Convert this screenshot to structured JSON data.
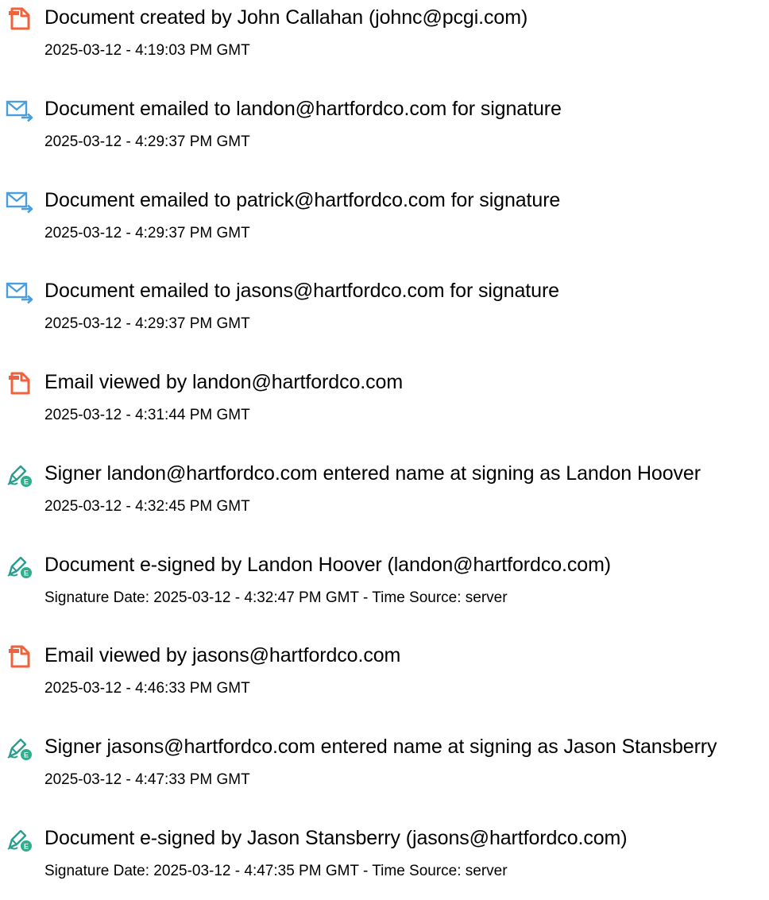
{
  "colors": {
    "doc_icon": "#f0623c",
    "email_icon": "#4a9ede",
    "sign_pen": "#2a9d8f",
    "sign_badge": "#2eaf8c",
    "text": "#000000"
  },
  "events": [
    {
      "icon": "document-icon",
      "title": "Document created by John Callahan (johnc@pcgi.com)",
      "stamp": "2025-03-12 - 4:19:03 PM GMT"
    },
    {
      "icon": "email-sent-icon",
      "title": "Document emailed to landon@hartfordco.com for signature",
      "stamp": "2025-03-12 - 4:29:37 PM GMT"
    },
    {
      "icon": "email-sent-icon",
      "title": "Document emailed to patrick@hartfordco.com for signature",
      "stamp": "2025-03-12 - 4:29:37 PM GMT"
    },
    {
      "icon": "email-sent-icon",
      "title": "Document emailed to jasons@hartfordco.com for signature",
      "stamp": "2025-03-12 - 4:29:37 PM GMT"
    },
    {
      "icon": "document-icon",
      "title": "Email viewed by landon@hartfordco.com",
      "stamp": "2025-03-12 - 4:31:44 PM GMT"
    },
    {
      "icon": "e-sign-icon",
      "badge": "E",
      "title": "Signer landon@hartfordco.com entered name at signing as Landon Hoover",
      "stamp": "2025-03-12 - 4:32:45 PM GMT"
    },
    {
      "icon": "e-sign-icon",
      "badge": "E",
      "title": "Document e-signed by Landon Hoover (landon@hartfordco.com)",
      "stamp": "Signature Date: 2025-03-12 - 4:32:47 PM GMT - Time Source: server"
    },
    {
      "icon": "document-icon",
      "title": "Email viewed by jasons@hartfordco.com",
      "stamp": "2025-03-12 - 4:46:33 PM GMT"
    },
    {
      "icon": "e-sign-icon",
      "badge": "E",
      "title": "Signer jasons@hartfordco.com entered name at signing as Jason Stansberry",
      "stamp": "2025-03-12 - 4:47:33 PM GMT"
    },
    {
      "icon": "e-sign-icon",
      "badge": "E",
      "title": "Document e-signed by Jason Stansberry (jasons@hartfordco.com)",
      "stamp": "Signature Date: 2025-03-12 - 4:47:35 PM GMT - Time Source: server"
    }
  ]
}
